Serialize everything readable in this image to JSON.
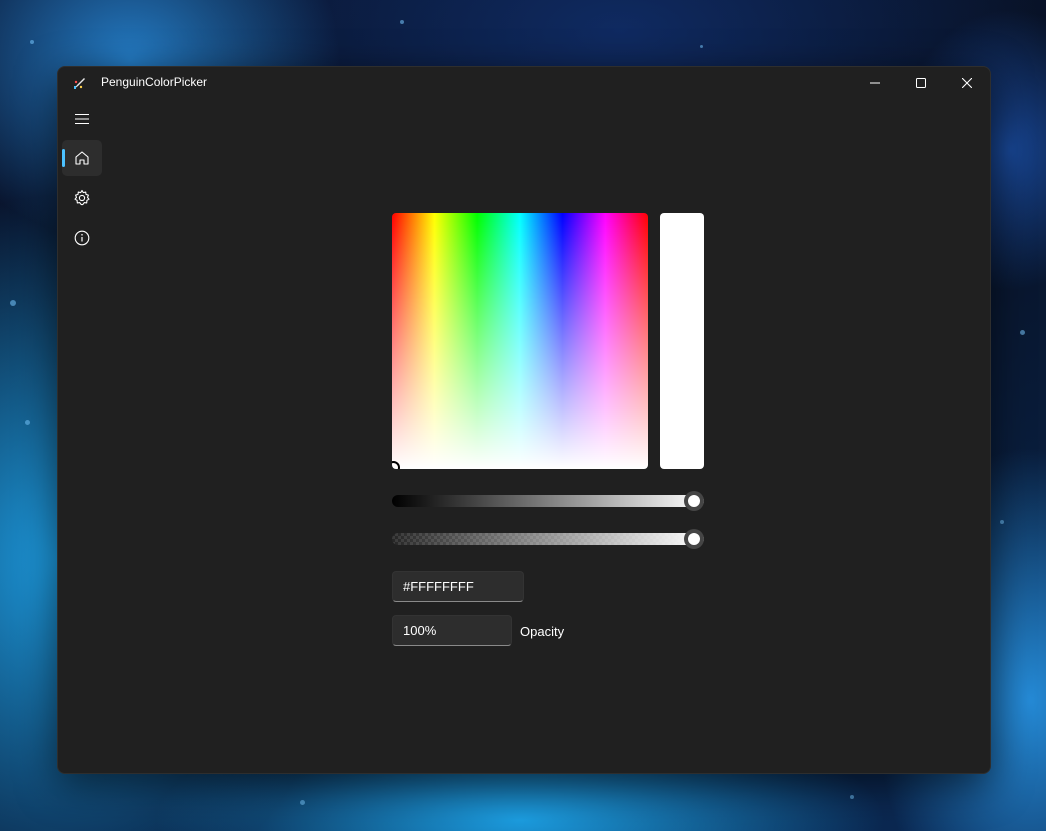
{
  "window": {
    "title": "PenguinColorPicker"
  },
  "caption_buttons": {
    "minimize_icon": "minimize-icon",
    "maximize_icon": "maximize-icon",
    "close_icon": "close-icon"
  },
  "nav": {
    "items": [
      {
        "id": "menu",
        "icon": "hamburger-icon"
      },
      {
        "id": "home",
        "icon": "home-icon",
        "selected": true
      },
      {
        "id": "settings",
        "icon": "gear-icon"
      },
      {
        "id": "about",
        "icon": "info-icon"
      }
    ]
  },
  "color_picker": {
    "selected_color": "#FFFFFF",
    "hex_value": "#FFFFFFFF",
    "opacity_value": "100%",
    "opacity_label": "Opacity",
    "value_slider_level": 1.0,
    "alpha_slider_level": 1.0
  },
  "colors": {
    "accent": "#4cc2ff",
    "window_background": "#202020"
  }
}
